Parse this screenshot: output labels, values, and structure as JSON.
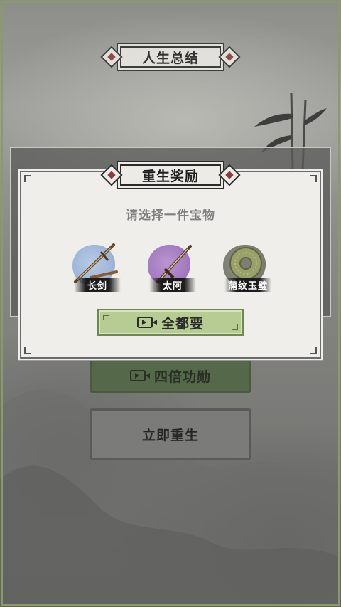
{
  "summary_banner": {
    "title": "人生总结"
  },
  "modal": {
    "title": "重生奖励",
    "subtitle": "请选择一件宝物",
    "items": [
      {
        "label": "长剑",
        "icon": "long-sword-icon",
        "color": "#9fb6d8"
      },
      {
        "label": "太阿",
        "icon": "taie-sword-icon",
        "color": "#a47bc0"
      },
      {
        "label": "蒲纹玉璧",
        "icon": "jade-disc-icon",
        "color": "#7d7f72"
      }
    ],
    "take_all_button": {
      "label": "全都要",
      "icon": "video-icon"
    }
  },
  "buttons": {
    "quad_merit": {
      "label": "四倍功勋",
      "icon": "video-icon"
    },
    "rebirth_now": {
      "label": "立即重生"
    }
  },
  "colors": {
    "accent_green": "#b7cc93",
    "diamond_red": "#8c3b3b"
  }
}
